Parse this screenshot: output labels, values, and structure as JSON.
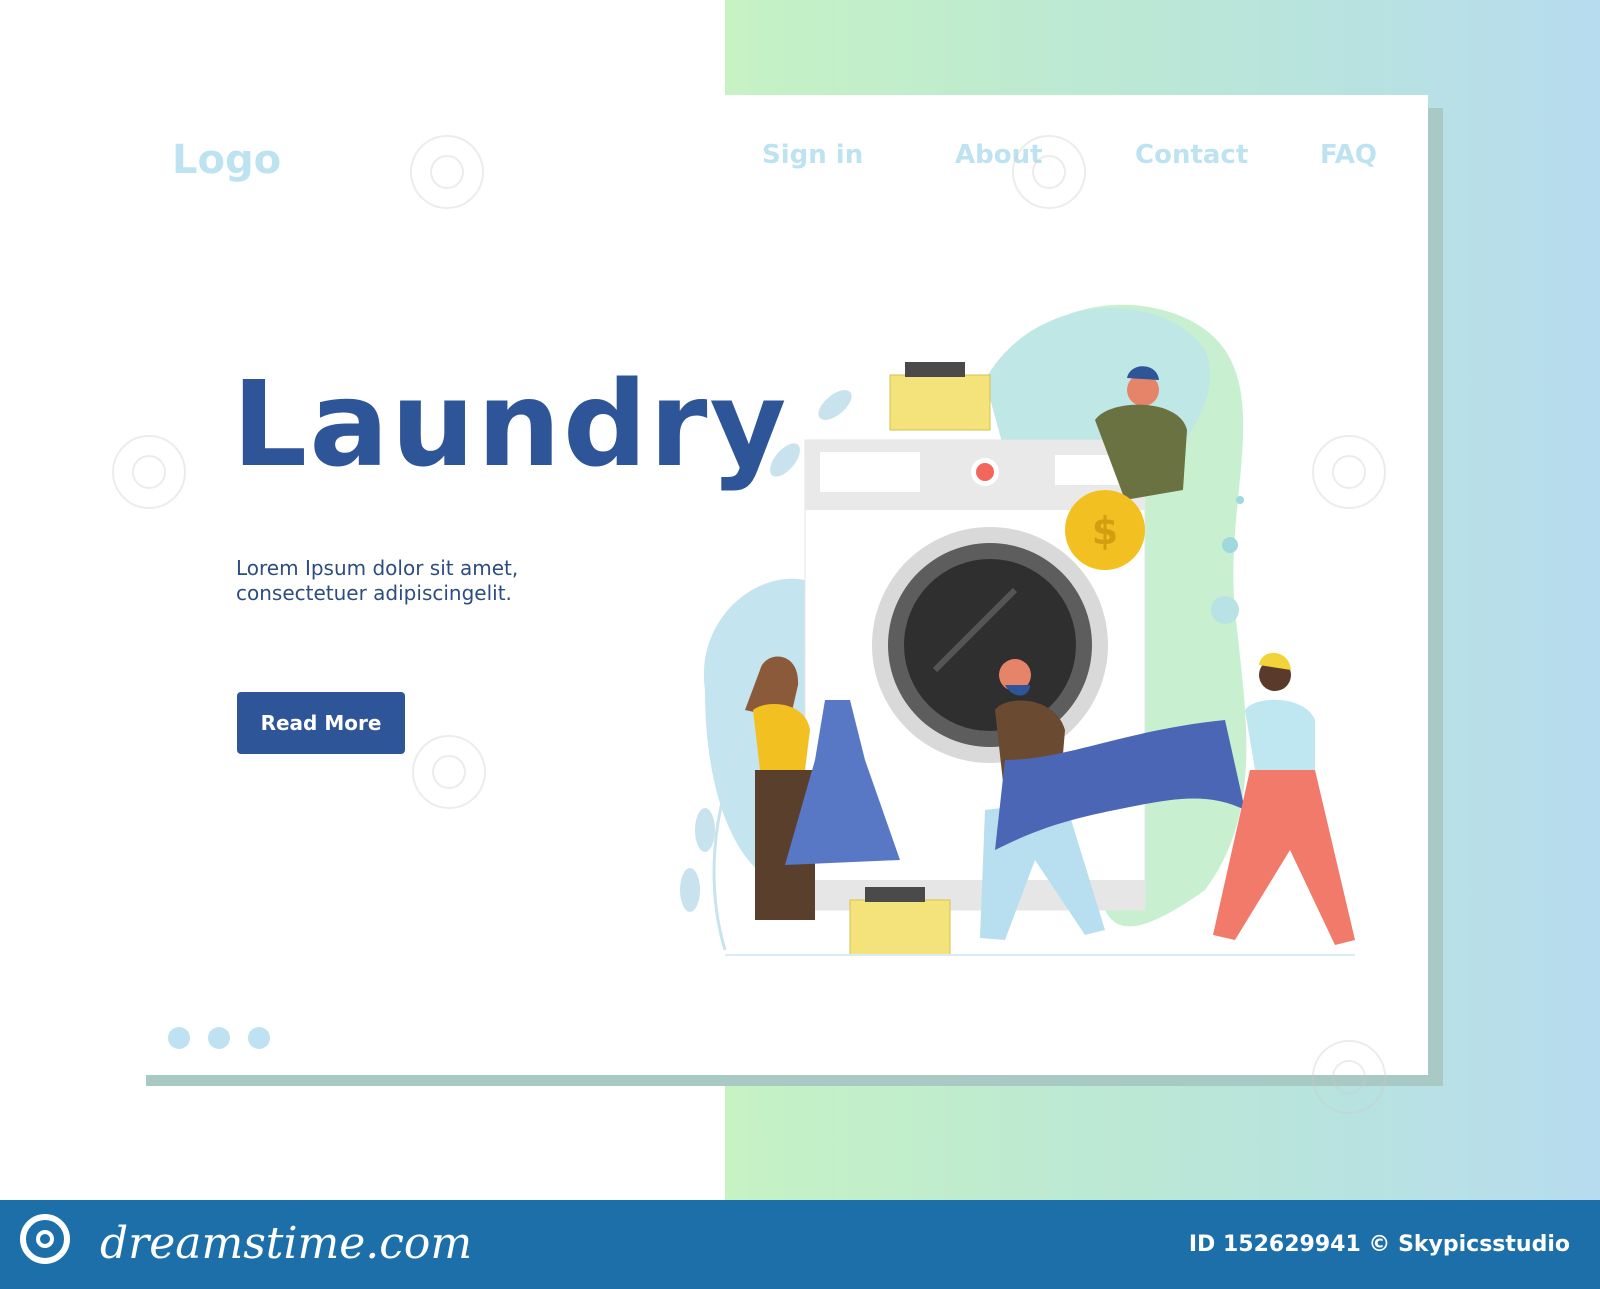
{
  "header": {
    "logo": "Logo",
    "nav": [
      "Sign in",
      "About",
      "Contact",
      "FAQ"
    ]
  },
  "hero": {
    "title": "Laundry",
    "text_line1": "Lorem Ipsum dolor sit amet,",
    "text_line2": "consectetuer adipiscingelit.",
    "button": "Read More"
  },
  "carousel": {
    "dots": 3
  },
  "footer": {
    "brand": "dreamstime.com",
    "id_text": "ID 152629941 © Skypicsstudio"
  },
  "colors": {
    "primary": "#2d5598",
    "nav_text": "#bde3f0",
    "footer_bg": "#1d6fa9",
    "gradient_left": "#c6f2c4",
    "gradient_right": "#b7dcef"
  }
}
